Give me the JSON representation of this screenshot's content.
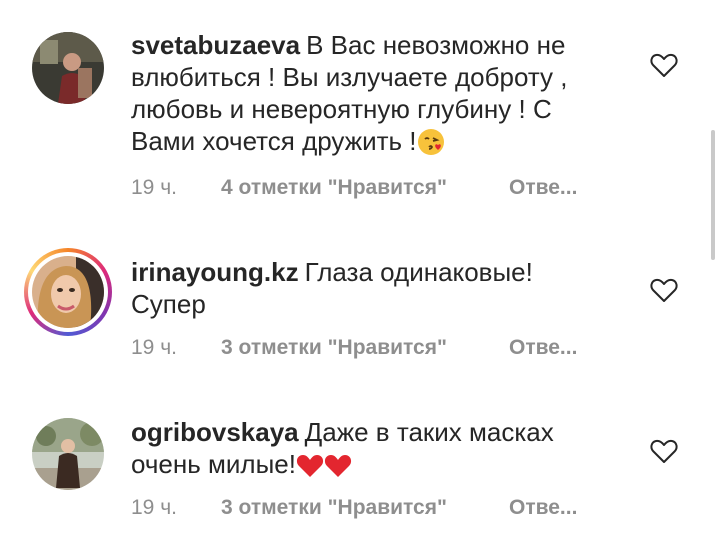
{
  "comments": [
    {
      "username": "svetabuzaeva",
      "text": "В Вас невозможно не влюбиться ! Вы излучаете доброту , любовь  и невероятную глубину ! С Вами хочется дружить !",
      "emoji": "kissing-face-heart",
      "time": "19 ч.",
      "likes": "4 отметки \"Нравится\"",
      "reply": "Отве..."
    },
    {
      "username": "irinayoung.kz",
      "text": "Глаза одинаковые! Супер",
      "time": "19 ч.",
      "likes": "3 отметки \"Нравится\"",
      "reply": "Отве..."
    },
    {
      "username": "ogribovskaya",
      "text": "Даже в таких масках очень милые!",
      "emoji": "red-hearts",
      "time": "19 ч.",
      "likes": "3 отметки \"Нравится\"",
      "reply": "Отве..."
    }
  ],
  "colors": {
    "text": "#262626",
    "muted": "#8e8e8e",
    "heart_outline": "#262626",
    "red_heart": "#e3262f"
  }
}
